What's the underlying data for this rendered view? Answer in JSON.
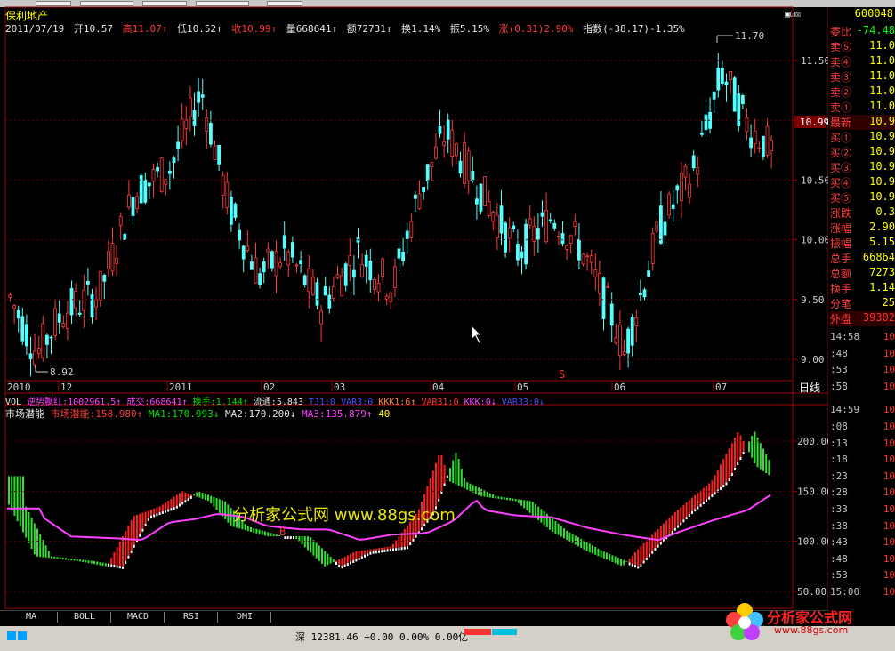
{
  "stock": {
    "name": "保利地产",
    "code": "600048"
  },
  "window_controls": "▣⊡☒",
  "ohlc_bar": {
    "date": "2011/07/19",
    "open": "开10.57",
    "high": "高11.07↑",
    "low": "低10.52↑",
    "close": "收10.99↑",
    "volume": "量668641↑",
    "amount": "额72731↑",
    "turnover": "换1.14%",
    "amplitude": "振5.15%",
    "change": "涨(0.31)2.90%",
    "index": "指数(-38.17)-1.35%"
  },
  "price_axis": [
    "11.50",
    "11.00",
    "10.50",
    "10.00",
    "9.50",
    "9.00"
  ],
  "price_max_label": "11.70",
  "price_min_label": "8.92",
  "last_price_tag": "10.99",
  "date_axis": [
    "2010",
    "12",
    "2011",
    "02",
    "03",
    "04",
    "05",
    "06",
    "07"
  ],
  "period_label": "日线",
  "signal_s": "S",
  "signal_b": "B",
  "indicator_vol": {
    "vol": "VOL",
    "name": "逆势飘红:",
    "name_val": "1002961.5↑",
    "chengjiao": "成交:",
    "chengjiao_val": "668641↑",
    "huanshou": "换手:",
    "huanshou_val": "1.144↑",
    "liutong": "流通:",
    "liutong_val": "5.843",
    "tj1": "TJ1:0",
    "var3": "VAR3:0",
    "kkk1": "KKK1:6↑",
    "var31": "VAR31:0",
    "kkk": "KKK:0↓",
    "var33": "VAR33:0↓"
  },
  "indicator_main": {
    "title": "市场潜能",
    "name": "市场潜能:",
    "name_val": "158.980↑",
    "ma1": "MA1:170.993↓",
    "ma2": "MA2:170.200↓",
    "ma3": "MA3:135.879↑",
    "extra": "40"
  },
  "indicator_axis": [
    "200.00",
    "150.00",
    "100.00",
    "50.00"
  ],
  "tabs": [
    "MA",
    "BOLL",
    "MACD",
    "RSI",
    "DMI"
  ],
  "quote_panel": {
    "ratio_label": "委比",
    "ratio_val": "-74.48",
    "rows": [
      {
        "label": "卖⑤",
        "value": "11.0"
      },
      {
        "label": "卖④",
        "value": "11.0"
      },
      {
        "label": "卖③",
        "value": "11.0"
      },
      {
        "label": "卖②",
        "value": "11.0"
      },
      {
        "label": "卖①",
        "value": "11.0"
      },
      {
        "label": "最新",
        "value": "10.9"
      },
      {
        "label": "买①",
        "value": "10.9"
      },
      {
        "label": "买②",
        "value": "10.9"
      },
      {
        "label": "买③",
        "value": "10.9"
      },
      {
        "label": "买④",
        "value": "10.9"
      },
      {
        "label": "买⑤",
        "value": "10.9"
      },
      {
        "label": "涨跌",
        "value": "0.3"
      },
      {
        "label": "涨幅",
        "value": "2.90"
      },
      {
        "label": "振幅",
        "value": "5.15"
      },
      {
        "label": "总手",
        "value": "66864"
      },
      {
        "label": "总额",
        "value": "7273"
      },
      {
        "label": "换手",
        "value": "1.14"
      },
      {
        "label": "分笔",
        "value": "25"
      }
    ],
    "outer_label": "外盘",
    "outer_val": "39302",
    "ticks": [
      {
        "time": "14:58",
        "v": "10"
      },
      {
        "time": ":48",
        "v": "10"
      },
      {
        "time": ":53",
        "v": "10"
      },
      {
        "time": ":58",
        "v": "10"
      },
      {
        "time": "14:59",
        "v": "10"
      },
      {
        "time": ":08",
        "v": "10"
      },
      {
        "time": ":13",
        "v": "10"
      },
      {
        "time": ":18",
        "v": "10"
      },
      {
        "time": ":23",
        "v": "10"
      },
      {
        "time": ":28",
        "v": "10"
      },
      {
        "time": ":33",
        "v": "10"
      },
      {
        "time": ":38",
        "v": "10"
      },
      {
        "time": ":43",
        "v": "10"
      },
      {
        "time": ":48",
        "v": "10"
      },
      {
        "time": ":53",
        "v": "10"
      },
      {
        "time": "15:00",
        "v": "10"
      }
    ]
  },
  "status_bar": "深 12381.46 +0.00 0.00% 0.00亿",
  "watermark": "分析家公式网 www.88gs.com",
  "logo_text": "分析家公式网",
  "logo_url": "www.88gs.com",
  "colors": {
    "up": "#ff3b3b",
    "down": "#54ffff",
    "ma": "#ff40ff",
    "bg": "#000000"
  }
}
